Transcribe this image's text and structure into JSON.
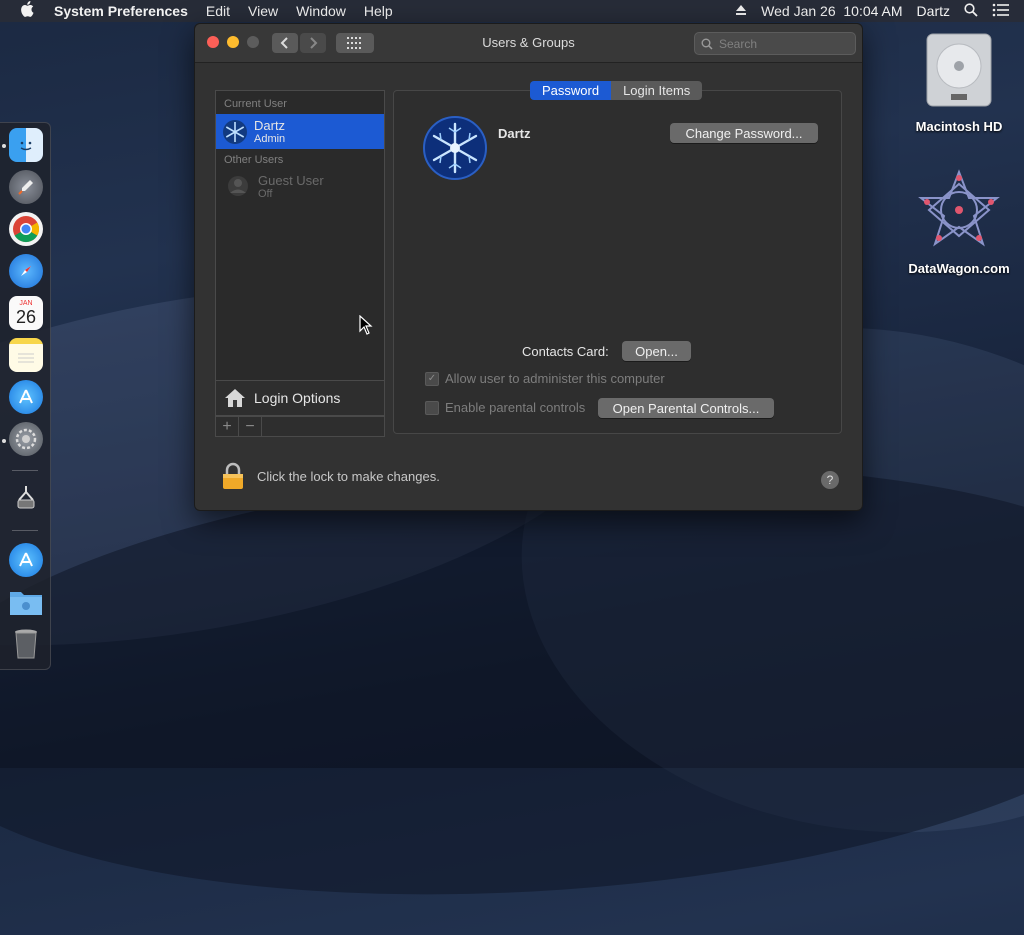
{
  "menubar": {
    "app_name": "System Preferences",
    "items": [
      "Edit",
      "View",
      "Window",
      "Help"
    ],
    "datetime": "Wed Jan 26  10:04 AM",
    "user": "Dartz"
  },
  "desktop": {
    "icons": [
      {
        "label": "Macintosh HD",
        "icon": "hard-drive-icon"
      },
      {
        "label": "DataWagon.com",
        "icon": "datawagon-logo-icon"
      }
    ]
  },
  "dock": {
    "items": [
      "finder-icon",
      "launchpad-icon",
      "chrome-icon",
      "safari-icon",
      "calendar-icon",
      "notes-icon",
      "app-store-icon",
      "system-preferences-icon",
      "apps-icon",
      "app-store-icon",
      "folder-icon",
      "trash-icon"
    ],
    "calendar_month": "JAN",
    "calendar_day": "26"
  },
  "window": {
    "title": "Users & Groups",
    "search_placeholder": "Search",
    "tabs": [
      "Password",
      "Login Items"
    ],
    "current_user_section": "Current User",
    "other_users_section": "Other Users",
    "current_user": {
      "name": "Dartz",
      "role": "Admin"
    },
    "guest_user": {
      "name": "Guest User",
      "status": "Off"
    },
    "login_options": "Login Options",
    "add_symbol": "+",
    "remove_symbol": "−",
    "profile_name": "Dartz",
    "change_password_button": "Change Password...",
    "contacts_label": "Contacts Card:",
    "open_button": "Open...",
    "allow_admin_checkbox": "Allow user to administer this computer",
    "parental_checkbox": "Enable parental controls",
    "open_parental_button": "Open Parental Controls...",
    "lock_text": "Click the lock to make changes.",
    "help_symbol": "?"
  },
  "colors": {
    "accent": "#1c5ad3",
    "window_bg": "#323232"
  }
}
